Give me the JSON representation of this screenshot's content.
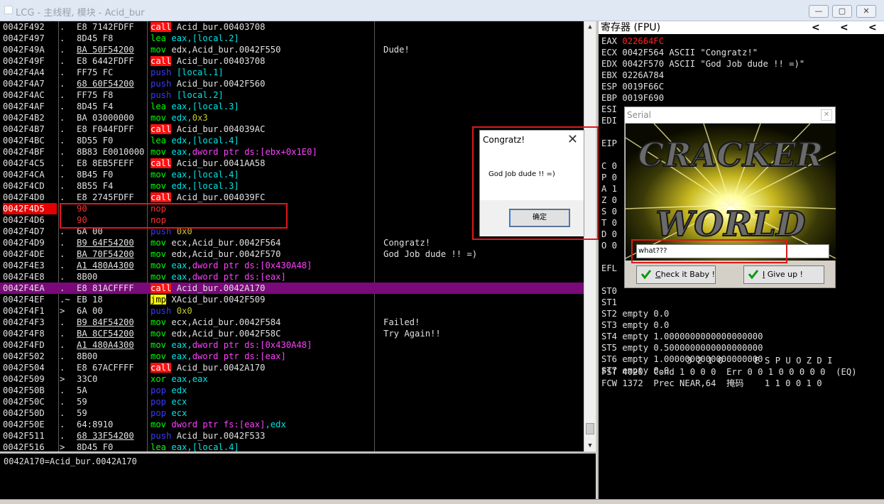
{
  "window": {
    "title": "LCG - 主线程, 模块 - Acid_bur",
    "minimize": "—",
    "maximize": "▢",
    "close": "✕"
  },
  "disasm": {
    "rows": [
      {
        "addr": "0042F492",
        "mark": ".",
        "hex": "E8 7142FDFF",
        "mn": "call",
        "ops": [
          {
            "t": "Acid_bur.00403708",
            "k": "op-w"
          }
        ],
        "com": ""
      },
      {
        "addr": "0042F497",
        "mark": ".",
        "hex": "8D45 F8",
        "mn": "lea",
        "ops": [
          {
            "t": "eax,",
            "k": "op"
          },
          {
            "t": "[local.2]",
            "k": "op"
          }
        ],
        "com": ""
      },
      {
        "addr": "0042F49A",
        "mark": ".",
        "hex": "BA 50F54200",
        "hexu": true,
        "mn": "mov",
        "ops": [
          {
            "t": "edx,",
            "k": "op-w"
          },
          {
            "t": "Acid_bur.0042F550",
            "k": "op-w"
          }
        ],
        "com": "Dude!"
      },
      {
        "addr": "0042F49F",
        "mark": ".",
        "hex": "E8 6442FDFF",
        "mn": "call",
        "ops": [
          {
            "t": "Acid_bur.00403708",
            "k": "op-w"
          }
        ],
        "com": ""
      },
      {
        "addr": "0042F4A4",
        "mark": ".",
        "hex": "FF75 FC",
        "mn": "push",
        "ops": [
          {
            "t": "[local.1]",
            "k": "op"
          }
        ],
        "com": ""
      },
      {
        "addr": "0042F4A7",
        "mark": ".",
        "hex": "68 60F54200",
        "hexu": true,
        "mn": "push",
        "ops": [
          {
            "t": "Acid_bur.0042F560",
            "k": "op-w"
          }
        ],
        "com": ""
      },
      {
        "addr": "0042F4AC",
        "mark": ".",
        "hex": "FF75 F8",
        "mn": "push",
        "ops": [
          {
            "t": "[local.2]",
            "k": "op"
          }
        ],
        "com": ""
      },
      {
        "addr": "0042F4AF",
        "mark": ".",
        "hex": "8D45 F4",
        "mn": "lea",
        "ops": [
          {
            "t": "eax,",
            "k": "op"
          },
          {
            "t": "[local.3]",
            "k": "op"
          }
        ],
        "com": ""
      },
      {
        "addr": "0042F4B2",
        "mark": ".",
        "hex": "BA 03000000",
        "mn": "mov",
        "ops": [
          {
            "t": "edx,",
            "k": "op"
          },
          {
            "t": "0x3",
            "k": "op-y"
          }
        ],
        "com": ""
      },
      {
        "addr": "0042F4B7",
        "mark": ".",
        "hex": "E8 F044FDFF",
        "mn": "call",
        "ops": [
          {
            "t": "Acid_bur.004039AC",
            "k": "op-w"
          }
        ],
        "com": ""
      },
      {
        "addr": "0042F4BC",
        "mark": ".",
        "hex": "8D55 F0",
        "mn": "lea",
        "ops": [
          {
            "t": "edx,",
            "k": "op"
          },
          {
            "t": "[local.4]",
            "k": "op"
          }
        ],
        "com": ""
      },
      {
        "addr": "0042F4BF",
        "mark": ".",
        "hex": "8B83 E0010000",
        "mn": "mov",
        "ops": [
          {
            "t": "eax,",
            "k": "op"
          },
          {
            "t": "dword ptr ds:[ebx+0x1E0]",
            "k": "op-m"
          }
        ],
        "com": ""
      },
      {
        "addr": "0042F4C5",
        "mark": ".",
        "hex": "E8 8EB5FEFF",
        "mn": "call",
        "ops": [
          {
            "t": "Acid_bur.0041AA58",
            "k": "op-w"
          }
        ],
        "com": ""
      },
      {
        "addr": "0042F4CA",
        "mark": ".",
        "hex": "8B45 F0",
        "mn": "mov",
        "ops": [
          {
            "t": "eax,",
            "k": "op"
          },
          {
            "t": "[local.4]",
            "k": "op"
          }
        ],
        "com": ""
      },
      {
        "addr": "0042F4CD",
        "mark": ".",
        "hex": "8B55 F4",
        "mn": "mov",
        "ops": [
          {
            "t": "edx,",
            "k": "op"
          },
          {
            "t": "[local.3]",
            "k": "op"
          }
        ],
        "com": ""
      },
      {
        "addr": "0042F4D0",
        "mark": ".",
        "hex": "E8 2745FDFF",
        "mn": "call",
        "ops": [
          {
            "t": "Acid_bur.004039FC",
            "k": "op-w"
          }
        ],
        "com": ""
      },
      {
        "addr": "0042F4D5",
        "mark": "",
        "hex": "90",
        "hexred": true,
        "bp": true,
        "mn": "nop",
        "ops": [],
        "com": ""
      },
      {
        "addr": "0042F4D6",
        "mark": "",
        "hex": "90",
        "hexred": true,
        "mn": "nop",
        "ops": [],
        "com": ""
      },
      {
        "addr": "0042F4D7",
        "mark": ".",
        "hex": "6A 00",
        "mn": "push",
        "ops": [
          {
            "t": "0x0",
            "k": "op-y"
          }
        ],
        "com": ""
      },
      {
        "addr": "0042F4D9",
        "mark": ".",
        "hex": "B9 64F54200",
        "hexu": true,
        "mn": "mov",
        "ops": [
          {
            "t": "ecx,",
            "k": "op-w"
          },
          {
            "t": "Acid_bur.0042F564",
            "k": "op-w"
          }
        ],
        "com": "Congratz!"
      },
      {
        "addr": "0042F4DE",
        "mark": ".",
        "hex": "BA 70F54200",
        "hexu": true,
        "mn": "mov",
        "ops": [
          {
            "t": "edx,",
            "k": "op-w"
          },
          {
            "t": "Acid_bur.0042F570",
            "k": "op-w"
          }
        ],
        "com": "God Job dude !! =)"
      },
      {
        "addr": "0042F4E3",
        "mark": ".",
        "hex": "A1 480A4300",
        "hexu": true,
        "mn": "mov",
        "ops": [
          {
            "t": "eax,",
            "k": "op"
          },
          {
            "t": "dword ptr ds:[0x430A48]",
            "k": "op-m"
          }
        ],
        "com": ""
      },
      {
        "addr": "0042F4E8",
        "mark": ".",
        "hex": "8B00",
        "mn": "mov",
        "ops": [
          {
            "t": "eax,",
            "k": "op"
          },
          {
            "t": "dword ptr ds:[eax]",
            "k": "op-m"
          }
        ],
        "com": ""
      },
      {
        "addr": "0042F4EA",
        "mark": ".",
        "hex": "E8 81ACFFFF",
        "sel": true,
        "mn": "call",
        "ops": [
          {
            "t": "Acid_bur.0042A170",
            "k": "op-w"
          }
        ],
        "com": ""
      },
      {
        "addr": "0042F4EF",
        "mark": ".~",
        "hex": "EB 18",
        "mn": "jmp",
        "ops": [
          {
            "t": "XAcid_bur.0042F509",
            "k": "op-w"
          }
        ],
        "com": ""
      },
      {
        "addr": "0042F4F1",
        "mark": ">",
        "hex": "6A 00",
        "mn": "push",
        "ops": [
          {
            "t": "0x0",
            "k": "op-y"
          }
        ],
        "com": ""
      },
      {
        "addr": "0042F4F3",
        "mark": ".",
        "hex": "B9 84F54200",
        "hexu": true,
        "mn": "mov",
        "ops": [
          {
            "t": "ecx,",
            "k": "op-w"
          },
          {
            "t": "Acid_bur.0042F584",
            "k": "op-w"
          }
        ],
        "com": "Failed!"
      },
      {
        "addr": "0042F4F8",
        "mark": ".",
        "hex": "BA 8CF54200",
        "hexu": true,
        "mn": "mov",
        "ops": [
          {
            "t": "edx,",
            "k": "op-w"
          },
          {
            "t": "Acid_bur.0042F58C",
            "k": "op-w"
          }
        ],
        "com": "Try Again!!"
      },
      {
        "addr": "0042F4FD",
        "mark": ".",
        "hex": "A1 480A4300",
        "hexu": true,
        "mn": "mov",
        "ops": [
          {
            "t": "eax,",
            "k": "op"
          },
          {
            "t": "dword ptr ds:[0x430A48]",
            "k": "op-m"
          }
        ],
        "com": ""
      },
      {
        "addr": "0042F502",
        "mark": ".",
        "hex": "8B00",
        "mn": "mov",
        "ops": [
          {
            "t": "eax,",
            "k": "op"
          },
          {
            "t": "dword ptr ds:[eax]",
            "k": "op-m"
          }
        ],
        "com": ""
      },
      {
        "addr": "0042F504",
        "mark": ".",
        "hex": "E8 67ACFFFF",
        "mn": "call",
        "ops": [
          {
            "t": "Acid_bur.0042A170",
            "k": "op-w"
          }
        ],
        "com": ""
      },
      {
        "addr": "0042F509",
        "mark": ">",
        "hex": "33C0",
        "mn": "xor",
        "ops": [
          {
            "t": "eax,eax",
            "k": "op"
          }
        ],
        "com": ""
      },
      {
        "addr": "0042F50B",
        "mark": ".",
        "hex": "5A",
        "mn": "pop",
        "ops": [
          {
            "t": "edx",
            "k": "op"
          }
        ],
        "com": ""
      },
      {
        "addr": "0042F50C",
        "mark": ".",
        "hex": "59",
        "mn": "pop",
        "ops": [
          {
            "t": "ecx",
            "k": "op"
          }
        ],
        "com": ""
      },
      {
        "addr": "0042F50D",
        "mark": ".",
        "hex": "59",
        "mn": "pop",
        "ops": [
          {
            "t": "ecx",
            "k": "op"
          }
        ],
        "com": ""
      },
      {
        "addr": "0042F50E",
        "mark": ".",
        "hex": "64:8910",
        "mn": "mov",
        "ops": [
          {
            "t": "dword ptr fs:[eax]",
            "k": "op-m"
          },
          {
            "t": ",edx",
            "k": "op"
          }
        ],
        "com": ""
      },
      {
        "addr": "0042F511",
        "mark": ".",
        "hex": "68 33F54200",
        "hexu": true,
        "mn": "push",
        "ops": [
          {
            "t": "Acid_bur.0042F533",
            "k": "op-w"
          }
        ],
        "com": ""
      },
      {
        "addr": "0042F516",
        "mark": ">",
        "hex": "8D45 F0",
        "mn": "lea",
        "ops": [
          {
            "t": "eax,",
            "k": "op"
          },
          {
            "t": "[local.4]",
            "k": "op"
          }
        ],
        "com": ""
      }
    ]
  },
  "info": {
    "line1": "0042A170=Acid_bur.0042A170"
  },
  "registers": {
    "header": "寄存器 (FPU)",
    "nav": [
      "<",
      "<",
      "<"
    ],
    "lines": [
      {
        "label": "EAX",
        "value": "022664FC",
        "red": true
      },
      {
        "label": "ECX",
        "value": "0042F564 ASCII \"Congratz!\""
      },
      {
        "label": "EDX",
        "value": "0042F570 ASCII \"God Job dude !! =)\""
      },
      {
        "label": "EBX",
        "value": "0226A784"
      },
      {
        "label": "ESP",
        "value": "0019F66C"
      },
      {
        "label": "EBP",
        "value": "0019F690"
      },
      {
        "label": "ESI",
        "value": ""
      },
      {
        "label": "EDI",
        "value": ""
      },
      {
        "label": "",
        "value": ""
      },
      {
        "label": "EIP",
        "value": ""
      },
      {
        "label": "",
        "value": ""
      },
      {
        "label": "C 0",
        "value": ""
      },
      {
        "label": "P 0",
        "value": ""
      },
      {
        "label": "A 1",
        "value": ""
      },
      {
        "label": "Z 0",
        "value": ""
      },
      {
        "label": "S 0",
        "value": ""
      },
      {
        "label": "T 0",
        "value": ""
      },
      {
        "label": "D 0",
        "value": ""
      },
      {
        "label": "O 0",
        "value": ""
      },
      {
        "label": "",
        "value": ""
      },
      {
        "label": "EFL",
        "value": ""
      },
      {
        "label": "",
        "value": ""
      },
      {
        "label": "ST0",
        "value": ""
      },
      {
        "label": "ST1",
        "value": ""
      },
      {
        "label": "ST2",
        "value": "empty 0.0"
      },
      {
        "label": "ST3",
        "value": "empty 0.0"
      },
      {
        "label": "ST4",
        "value": "empty 1.0000000000000000000"
      },
      {
        "label": "ST5",
        "value": "empty 0.5000000000000000000"
      },
      {
        "label": "ST6",
        "value": "empty 1.0000000000000000000"
      },
      {
        "label": "ST7",
        "value": "empty 0.0"
      }
    ],
    "fpu_flags_header": "3 2 1 0      E S P U O Z D I",
    "fst": "FST 4020  Cond 1 0 0 0  Err 0 0 1 0 0 0 0 0  (EQ)",
    "fcw": "FCW 1372  Prec NEAR,64  掩码    1 1 0 0 1 0"
  },
  "msgbox": {
    "title": "Congratz!",
    "message": "God Job dude !! =)",
    "ok_label": "确定"
  },
  "serial": {
    "title": "Serial",
    "banner_top": "CRACKER",
    "banner_bottom": "WORLD",
    "input_value": "what???",
    "check_label_u": "C",
    "check_label": "heck it Baby !",
    "giveup_label_u": "I",
    "giveup_label": " Give up !"
  }
}
